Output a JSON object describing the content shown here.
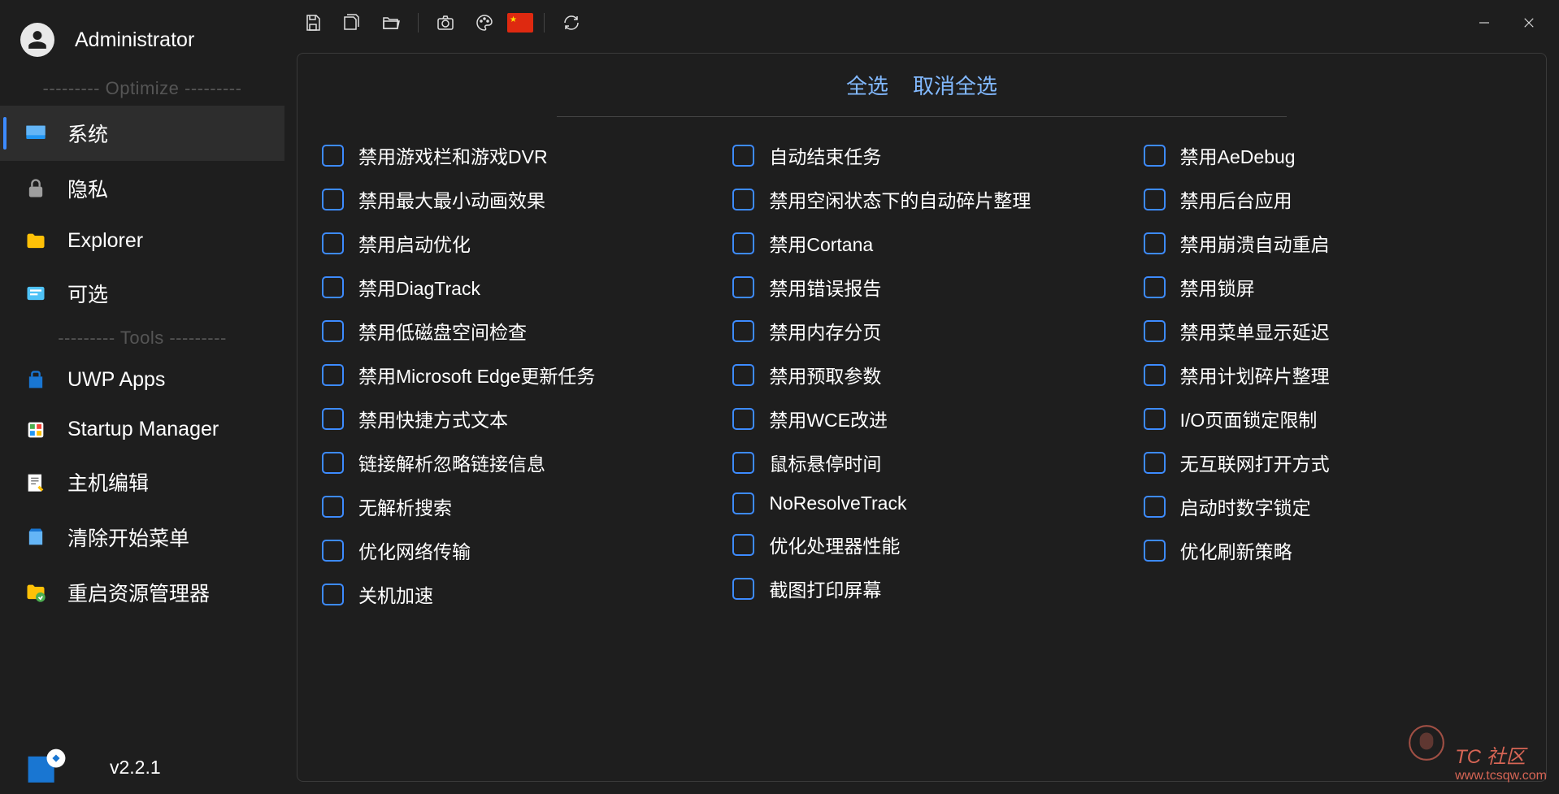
{
  "user": {
    "name": "Administrator"
  },
  "sections": {
    "optimize": "--------- Optimize ---------",
    "tools": "--------- Tools ---------"
  },
  "nav": {
    "system": "系统",
    "privacy": "隐私",
    "explorer": "Explorer",
    "optional": "可选",
    "uwp": "UWP Apps",
    "startup": "Startup Manager",
    "hostedit": "主机编辑",
    "clearstart": "清除开始菜单",
    "restartexplorer": "重启资源管理器"
  },
  "version": "v2.2.1",
  "selectControls": {
    "all": "全选",
    "none": "取消全选"
  },
  "options": {
    "col1": [
      "禁用游戏栏和游戏DVR",
      "禁用最大最小动画效果",
      "禁用启动优化",
      "禁用DiagTrack",
      "禁用低磁盘空间检查",
      "禁用Microsoft Edge更新任务",
      "禁用快捷方式文本",
      "链接解析忽略链接信息",
      "无解析搜索",
      "优化网络传输",
      "关机加速"
    ],
    "col2": [
      "自动结束任务",
      "禁用空闲状态下的自动碎片整理",
      "禁用Cortana",
      "禁用错误报告",
      "禁用内存分页",
      "禁用预取参数",
      "禁用WCE改进",
      "鼠标悬停时间",
      "NoResolveTrack",
      "优化处理器性能",
      "截图打印屏幕"
    ],
    "col3": [
      "禁用AeDebug",
      "禁用后台应用",
      "禁用崩溃自动重启",
      "禁用锁屏",
      "禁用菜单显示延迟",
      "禁用计划碎片整理",
      "I/O页面锁定限制",
      "无互联网打开方式",
      "启动时数字锁定",
      "优化刷新策略"
    ]
  },
  "watermark": {
    "brand": "TC 社区",
    "url": "www.tcsqw.com"
  }
}
